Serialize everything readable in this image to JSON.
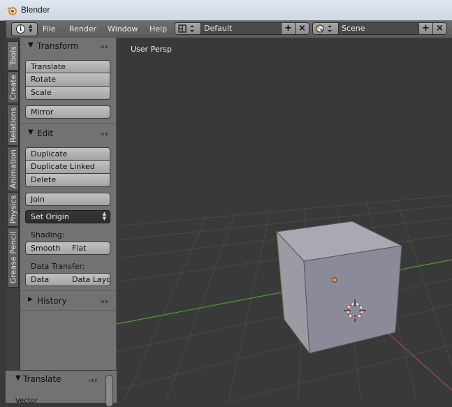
{
  "window": {
    "title": "Blender"
  },
  "header": {
    "menus": [
      "File",
      "Render",
      "Window",
      "Help"
    ],
    "screen_layout": "Default",
    "scene": "Scene"
  },
  "tabs": [
    "Tools",
    "Create",
    "Relations",
    "Animation",
    "Physics",
    "Grease Pencil"
  ],
  "toolshelf": {
    "transform": {
      "title": "Transform",
      "buttons": [
        "Translate",
        "Rotate",
        "Scale"
      ],
      "mirror": "Mirror"
    },
    "edit": {
      "title": "Edit",
      "buttons": [
        "Duplicate",
        "Duplicate Linked",
        "Delete"
      ],
      "join": "Join",
      "set_origin": "Set Origin",
      "shading_label": "Shading:",
      "shading_buttons": [
        "Smooth",
        "Flat"
      ],
      "data_transfer_label": "Data Transfer:",
      "data_transfer_buttons": [
        "Data",
        "Data Layo"
      ]
    },
    "history": {
      "title": "History"
    }
  },
  "operator_panel": {
    "title": "Translate",
    "first_field": "Vector"
  },
  "viewport": {
    "view_label": "User Persp",
    "colors": {
      "x_axis": "#a34a4a",
      "y_axis": "#4f9d3a",
      "cube_top": "#a9a9b4",
      "cube_front": "#8a8a98",
      "cube_side": "#9b9ba4"
    }
  }
}
